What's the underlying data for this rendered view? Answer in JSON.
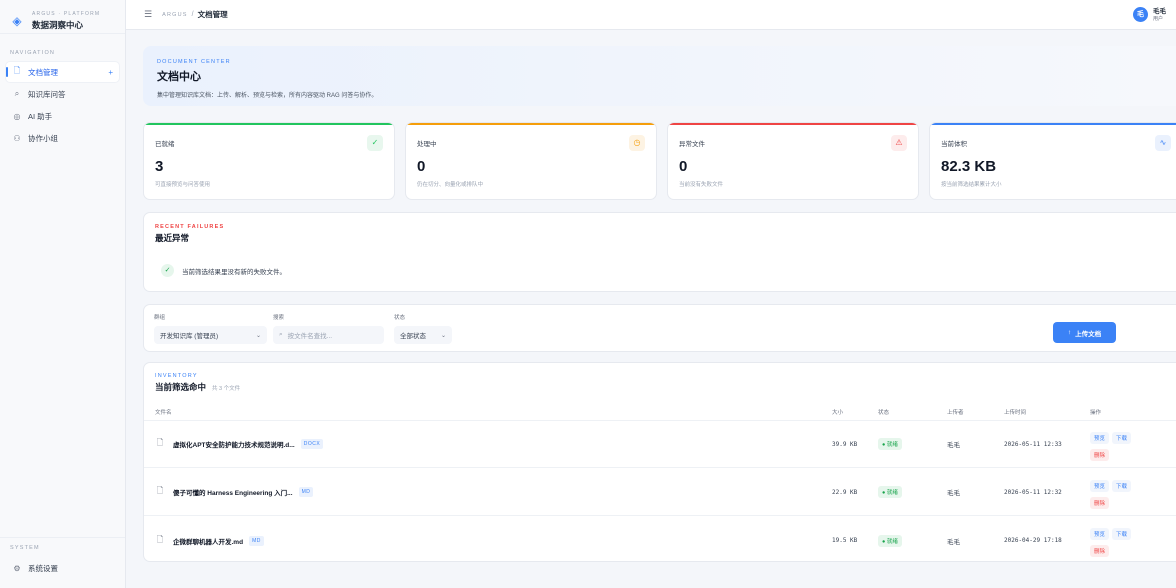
{
  "brand": {
    "subtitle": "ARGUS · PLATFORM",
    "title": "数据洞察中心"
  },
  "nav": {
    "caption": "NAVIGATION",
    "items": [
      {
        "label": "文档管理",
        "icon": "document-icon"
      },
      {
        "label": "知识库问答",
        "icon": "search-icon"
      },
      {
        "label": "AI 助手",
        "icon": "ai-icon"
      },
      {
        "label": "协作小组",
        "icon": "users-icon"
      }
    ],
    "plus": "+"
  },
  "system": {
    "caption": "SYSTEM",
    "settings_label": "系统设置"
  },
  "topbar": {
    "crumb_root": "ARGUS",
    "crumb_sep": "/",
    "crumb_current": "文档管理"
  },
  "user": {
    "avatar_text": "毛",
    "name": "毛毛",
    "role": "用户"
  },
  "hero": {
    "kicker": "DOCUMENT CENTER",
    "title": "文档中心",
    "desc": "集中管理知识库文档：上传、解析、预览与检索，所有内容驱动 RAG 问答与协作。"
  },
  "stats": [
    {
      "label": "已就绪",
      "value": "3",
      "desc": "可直接预览与问答使用",
      "icon": "check-circle-icon",
      "accent": "#22c55e",
      "tint": "#e8f7ee"
    },
    {
      "label": "处理中",
      "value": "0",
      "desc": "仍在切分、向量化或排队中",
      "icon": "clock-icon",
      "accent": "#f59e0b",
      "tint": "#fdf3e3"
    },
    {
      "label": "异常文件",
      "value": "0",
      "desc": "当前没有失败文件",
      "icon": "warning-icon",
      "accent": "#ef4444",
      "tint": "#fdecec"
    },
    {
      "label": "当前体积",
      "value": "82.3 KB",
      "desc": "按当前筛选结果累计大小",
      "icon": "activity-icon",
      "accent": "#3b82f6",
      "tint": "#eaf1fd"
    }
  ],
  "failures": {
    "kicker": "RECENT FAILURES",
    "title": "最近异常",
    "message": "当前筛选结果里没有新的失败文件。"
  },
  "filters": {
    "group_label": "群组",
    "group_value": "开发知识库 (管理员)",
    "search_label": "搜索",
    "search_placeholder": "按文件名查找...",
    "status_label": "状态",
    "status_value": "全部状态",
    "upload_label": "上传文档"
  },
  "inventory": {
    "kicker": "INVENTORY",
    "title": "当前筛选命中",
    "count": "共 3 个文件",
    "columns": {
      "name": "文件名",
      "size": "大小",
      "status": "状态",
      "uploader": "上传者",
      "time": "上传时间",
      "actions": "操作"
    },
    "rows": [
      {
        "name": "虚拟化APT安全防护能力技术规范说明.d...",
        "type": "DOCX",
        "size": "39.9 KB",
        "status": "● 就绪",
        "uploader": "毛毛",
        "time": "2026-05-11 12:33",
        "preview": "预览",
        "download": "下载",
        "delete": "删除"
      },
      {
        "name": "傻子可懂的 Harness Engineering 入门...",
        "type": "MD",
        "size": "22.9 KB",
        "status": "● 就绪",
        "uploader": "毛毛",
        "time": "2026-05-11 12:32",
        "preview": "预览",
        "download": "下载",
        "delete": "删除"
      },
      {
        "name": "企微群聊机器人开发.md",
        "type": "MD",
        "size": "19.5 KB",
        "status": "● 就绪",
        "uploader": "毛毛",
        "time": "2026-04-29 17:18",
        "preview": "预览",
        "download": "下载",
        "delete": "删除"
      }
    ]
  }
}
